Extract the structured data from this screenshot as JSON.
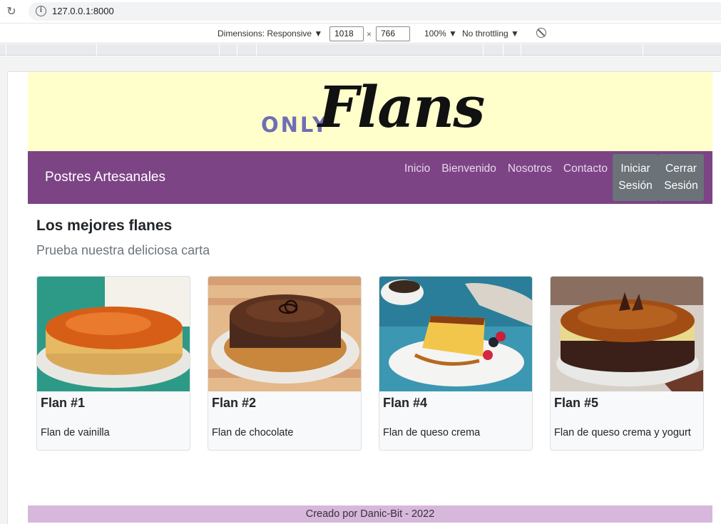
{
  "browser": {
    "url_host": "127.0.0.1:8000",
    "devtools": {
      "dimensions_label": "Dimensions: Responsive ▼",
      "width": "1018",
      "height": "766",
      "times": "×",
      "zoom": "100% ▼",
      "throttling": "No throttling ▼"
    }
  },
  "site": {
    "logo_small": "ONLY",
    "logo_big": "Flans",
    "brand": "Postres Artesanales",
    "nav": [
      "Inicio",
      "Bienvenido",
      "Nosotros",
      "Contacto"
    ],
    "login_line1": "Iniciar",
    "login_line2": "Sesión",
    "logout_line1": "Cerrar",
    "logout_line2": "Sesión"
  },
  "main": {
    "heading": "Los mejores flanes",
    "subheading": "Prueba nuestra deliciosa carta",
    "cards": [
      {
        "title": "Flan #1",
        "desc": "Flan de vainilla"
      },
      {
        "title": "Flan #2",
        "desc": "Flan de chocolate"
      },
      {
        "title": "Flan #4",
        "desc": "Flan de queso crema"
      },
      {
        "title": "Flan #5",
        "desc": "Flan de queso crema y yogurt"
      }
    ]
  },
  "footer": {
    "text": "Creado por Danic-Bit - 2022"
  },
  "colors": {
    "banner": "#ffffcc",
    "navbar": "#7c4485",
    "button": "#6b7278",
    "footer": "#d7b8dc"
  }
}
